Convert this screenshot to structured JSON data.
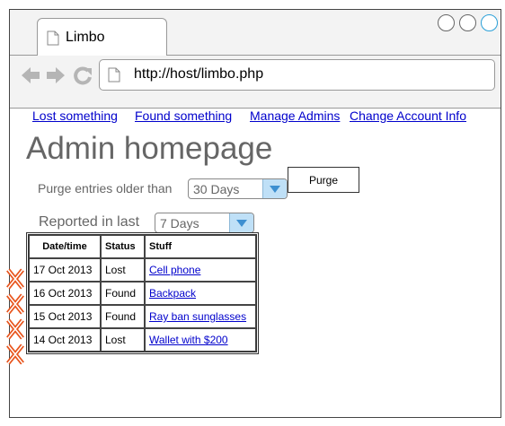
{
  "browser": {
    "tab_title": "Limbo",
    "url": "http://host/limbo.php"
  },
  "nav": {
    "lost": "Lost something",
    "found": "Found something",
    "admins": "Manage Admins",
    "account": "Change Account Info"
  },
  "page": {
    "title": "Admin homepage"
  },
  "purge": {
    "label": "Purge entries older than",
    "selected": "30 Days",
    "button": "Purge"
  },
  "reported": {
    "label": "Reported in last",
    "selected": "7 Days"
  },
  "table": {
    "headers": [
      "Date/time",
      "Status",
      "Stuff"
    ],
    "rows": [
      [
        "17 Oct 2013",
        "Lost",
        "Cell phone"
      ],
      [
        "16 Oct 2013",
        "Found",
        "Backpack"
      ],
      [
        "15 Oct 2013",
        "Found",
        "Ray ban sunglasses"
      ],
      [
        "14 Oct 2013",
        "Lost",
        "Wallet with $200"
      ]
    ]
  },
  "icons": {
    "delete": "delete-x-icon",
    "delete_color": "#e8541c",
    "page": "page-icon",
    "back": "back-arrow-icon",
    "forward": "forward-arrow-icon",
    "reload": "reload-icon",
    "accent": "#2aa0d8"
  }
}
